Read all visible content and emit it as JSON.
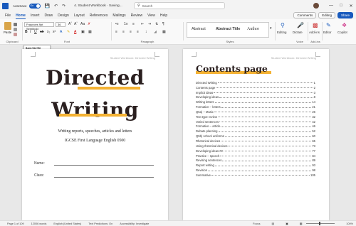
{
  "titlebar": {
    "autosave_label": "AutoSave",
    "autosave_state": "On",
    "document_name": "4. Student Workbook · Saving...",
    "search_placeholder": "Search"
  },
  "menu": {
    "items": [
      "File",
      "Home",
      "Insert",
      "Draw",
      "Design",
      "Layout",
      "References",
      "Mailings",
      "Review",
      "View",
      "Help"
    ],
    "comments_label": "Comments",
    "editing_label": "Editing",
    "share_label": "Share"
  },
  "ribbon": {
    "paste_label": "Paste",
    "font_name": "Fraunces 9pt Semibold",
    "font_size": "36",
    "styles": [
      "Abstract",
      "Abstract Title",
      "Author"
    ],
    "group_labels": [
      "Clipboard",
      "Font",
      "Paragraph",
      "Styles",
      "Voice",
      "Add-ins"
    ],
    "editing_button": "Editing",
    "dictate_button": "Dictate",
    "addins_button": "Add-ins",
    "editor_button": "Editor",
    "copilot_button": "Copilot"
  },
  "tooltip": {
    "title": "Bold (Ctrl+B)",
    "description": "Make your text bold."
  },
  "page_left": {
    "header": "Student Workbook: Directed Writing",
    "title_line1": "Directed",
    "title_line2": "Writing",
    "subtitle1": "Writing reports, speeches, articles and letters",
    "subtitle2": "IGCSE First Language English 0500",
    "name_label": "Name:",
    "class_label": "Class:"
  },
  "page_right": {
    "header": "Student Workbook: Directed Writing",
    "title": "Contents page",
    "toc": [
      {
        "t": "Directed Writing",
        "p": "1"
      },
      {
        "t": "Contents page",
        "p": "2"
      },
      {
        "t": "Implicit ideas",
        "p": "3"
      },
      {
        "t": "Developing ideas",
        "p": "8"
      },
      {
        "t": "Writing letters",
        "p": "14"
      },
      {
        "t": "Formative – letters",
        "p": "21"
      },
      {
        "t": "Q5a) – Music",
        "p": "26"
      },
      {
        "t": "Text type review",
        "p": "32"
      },
      {
        "t": "Varied sentences",
        "p": "42"
      },
      {
        "t": "Formative – article",
        "p": "46"
      },
      {
        "t": "Debate planning",
        "p": "52"
      },
      {
        "t": "Q5b) school uniforms",
        "p": "60"
      },
      {
        "t": "Rhetorical devices",
        "p": "65"
      },
      {
        "t": "Using rhetorical devices",
        "p": "73"
      },
      {
        "t": "Developing ideas #2",
        "p": "77"
      },
      {
        "t": "Practice – speech",
        "p": "84"
      },
      {
        "t": "Revising sentences",
        "p": "89"
      },
      {
        "t": "Report writing",
        "p": "93"
      },
      {
        "t": "Revision",
        "p": "98"
      },
      {
        "t": "Summative",
        "p": "105"
      }
    ]
  },
  "status": {
    "page": "Page 1 of 109",
    "words": "12006 words",
    "language": "English (United States)",
    "predictions": "Text Predictions: On",
    "accessibility": "Accessibility: Investigate",
    "focus": "Focus",
    "zoom": "100%"
  },
  "colors": {
    "accent": "#185abd",
    "highlight": "#f4b233"
  }
}
